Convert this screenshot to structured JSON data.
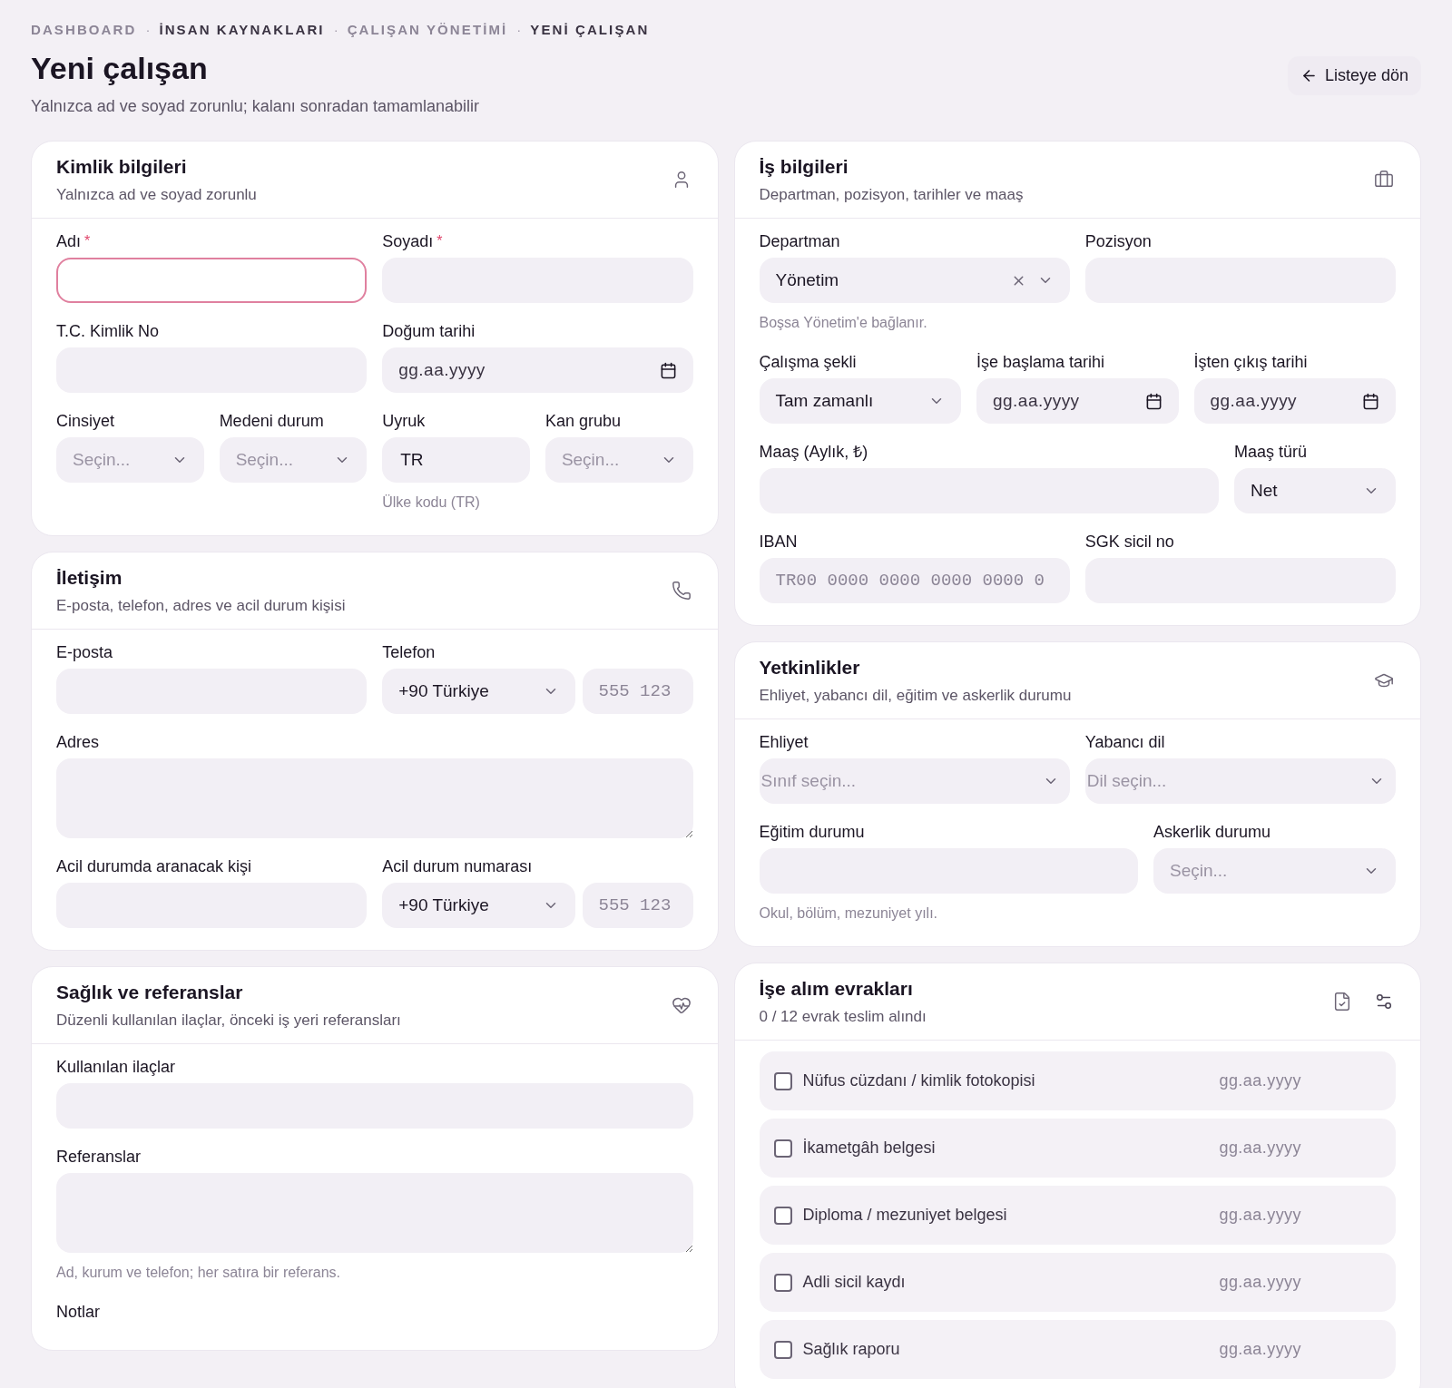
{
  "breadcrumb": [
    {
      "label": "DASHBOARD",
      "emphasis": false
    },
    {
      "label": "İNSAN KAYNAKLARI",
      "emphasis": true
    },
    {
      "label": "ÇALIŞAN YÖNETİMİ",
      "emphasis": false
    },
    {
      "label": "YENİ ÇALIŞAN",
      "emphasis": true
    }
  ],
  "breadcrumb_separator": "·",
  "page": {
    "title": "Yeni çalışan",
    "subtitle": "Yalnızca ad ve soyad zorunlu; kalanı sonradan tamamlanabilir",
    "back_button": "Listeye dön"
  },
  "left_column": [
    {
      "title": "Kimlik bilgileri",
      "subtitle": "Yalnızca ad ve soyad zorunlu",
      "rows": [
        {
          "fields": [
            {
              "kind": "text",
              "label": "Adı",
              "mark": "*",
              "focused": true
            },
            {
              "kind": "text",
              "label": "Soyadı",
              "mark": "*"
            }
          ]
        },
        {
          "fields": [
            {
              "kind": "text",
              "label": "T.C. Kimlik No"
            },
            {
              "kind": "date",
              "label": "Doğum tarihi",
              "placeholder": "gg.aa.yyyy"
            }
          ]
        },
        {
          "fields": [
            {
              "kind": "select",
              "label": "Cinsiyet",
              "placeholder": "Seçin..."
            },
            {
              "kind": "select",
              "label": "Medeni durum",
              "placeholder": "Seçin..."
            },
            {
              "kind": "text",
              "label": "Uyruk",
              "value": "TR",
              "hint": "Ülke kodu (TR)"
            },
            {
              "kind": "select",
              "label": "Kan grubu",
              "placeholder": "Seçin..."
            }
          ]
        }
      ]
    },
    {
      "title": "İletişim",
      "subtitle": "E-posta, telefon, adres ve acil durum kişisi",
      "rows": [
        {
          "fields": [
            {
              "kind": "text",
              "label": "E-posta"
            },
            {
              "kind": "phone",
              "label": "Telefon",
              "country": "+90 Türkiye",
              "placeholder": "555 123"
            }
          ]
        },
        {
          "fields": [
            {
              "kind": "textarea",
              "label": "Adres"
            }
          ]
        },
        {
          "fields": [
            {
              "kind": "text",
              "label": "Acil durumda aranacak kişi"
            },
            {
              "kind": "phone",
              "label": "Acil durum numarası",
              "country": "+90 Türkiye",
              "placeholder": "555 123"
            }
          ]
        }
      ]
    },
    {
      "title": "Sağlık ve referanslar",
      "subtitle": "Düzenli kullanılan ilaçlar, önceki iş yeri referansları",
      "rows": [
        {
          "fields": [
            {
              "kind": "text",
              "label": "Kullanılan ilaçlar"
            }
          ]
        },
        {
          "fields": [
            {
              "kind": "textarea",
              "label": "Referanslar",
              "hint": "Ad, kurum ve telefon; her satıra bir referans."
            }
          ]
        },
        {
          "fields": [
            {
              "kind": "label",
              "label": "Notlar"
            }
          ]
        }
      ]
    }
  ],
  "right_column": [
    {
      "title": "İş bilgileri",
      "subtitle": "Departman, pozisyon, tarihler ve maaş",
      "rows": [
        {
          "fields": [
            {
              "kind": "select",
              "label": "Departman",
              "value": "Yönetim",
              "clearable": true,
              "hint": "Boşsa Yönetim'e bağlanır."
            },
            {
              "kind": "text",
              "label": "Pozisyon"
            }
          ]
        },
        {
          "fields": [
            {
              "kind": "select",
              "label": "Çalışma şekli",
              "value": "Tam zamanlı"
            },
            {
              "kind": "date",
              "label": "İşe başlama tarihi",
              "placeholder": "gg.aa.yyyy"
            },
            {
              "kind": "date",
              "label": "İşten çıkış tarihi",
              "placeholder": "gg.aa.yyyy"
            }
          ]
        },
        {
          "fields": [
            {
              "kind": "text",
              "label": "Maaş (Aylık, ₺)"
            },
            {
              "kind": "select",
              "label": "Maaş türü",
              "value": "Net"
            }
          ]
        },
        {
          "fields": [
            {
              "kind": "mono",
              "label": "IBAN",
              "placeholder": "TR00 0000 0000 0000 0000 0"
            },
            {
              "kind": "text",
              "label": "SGK sicil no"
            }
          ]
        }
      ]
    },
    {
      "title": "Yetkinlikler",
      "subtitle": "Ehliyet, yabancı dil, eğitim ve askerlik durumu",
      "rows": [
        {
          "fields": [
            {
              "kind": "native",
              "label": "Ehliyet",
              "placeholder": "Sınıf seçin..."
            },
            {
              "kind": "native",
              "label": "Yabancı dil",
              "placeholder": "Dil seçin..."
            }
          ]
        },
        {
          "fields": [
            {
              "kind": "text",
              "label": "Eğitim durumu",
              "hint": "Okul, bölüm, mezuniyet yılı."
            },
            {
              "kind": "select",
              "label": "Askerlik durumu",
              "placeholder": "Seçin..."
            }
          ]
        }
      ]
    },
    {
      "title": "İşe alım evrakları",
      "subtitle": "0 / 12 evrak teslim alındı",
      "items": [
        {
          "label": "Nüfus cüzdanı / kimlik fotokopisi",
          "checked": false,
          "date": "gg.aa.yyyy"
        },
        {
          "label": "İkametgâh belgesi",
          "checked": false,
          "date": "gg.aa.yyyy"
        },
        {
          "label": "Diploma / mezuniyet belgesi",
          "checked": false,
          "date": "gg.aa.yyyy"
        },
        {
          "label": "Adli sicil kaydı",
          "checked": false,
          "date": "gg.aa.yyyy"
        },
        {
          "label": "Sağlık raporu",
          "checked": false,
          "date": "gg.aa.yyyy"
        }
      ]
    }
  ]
}
